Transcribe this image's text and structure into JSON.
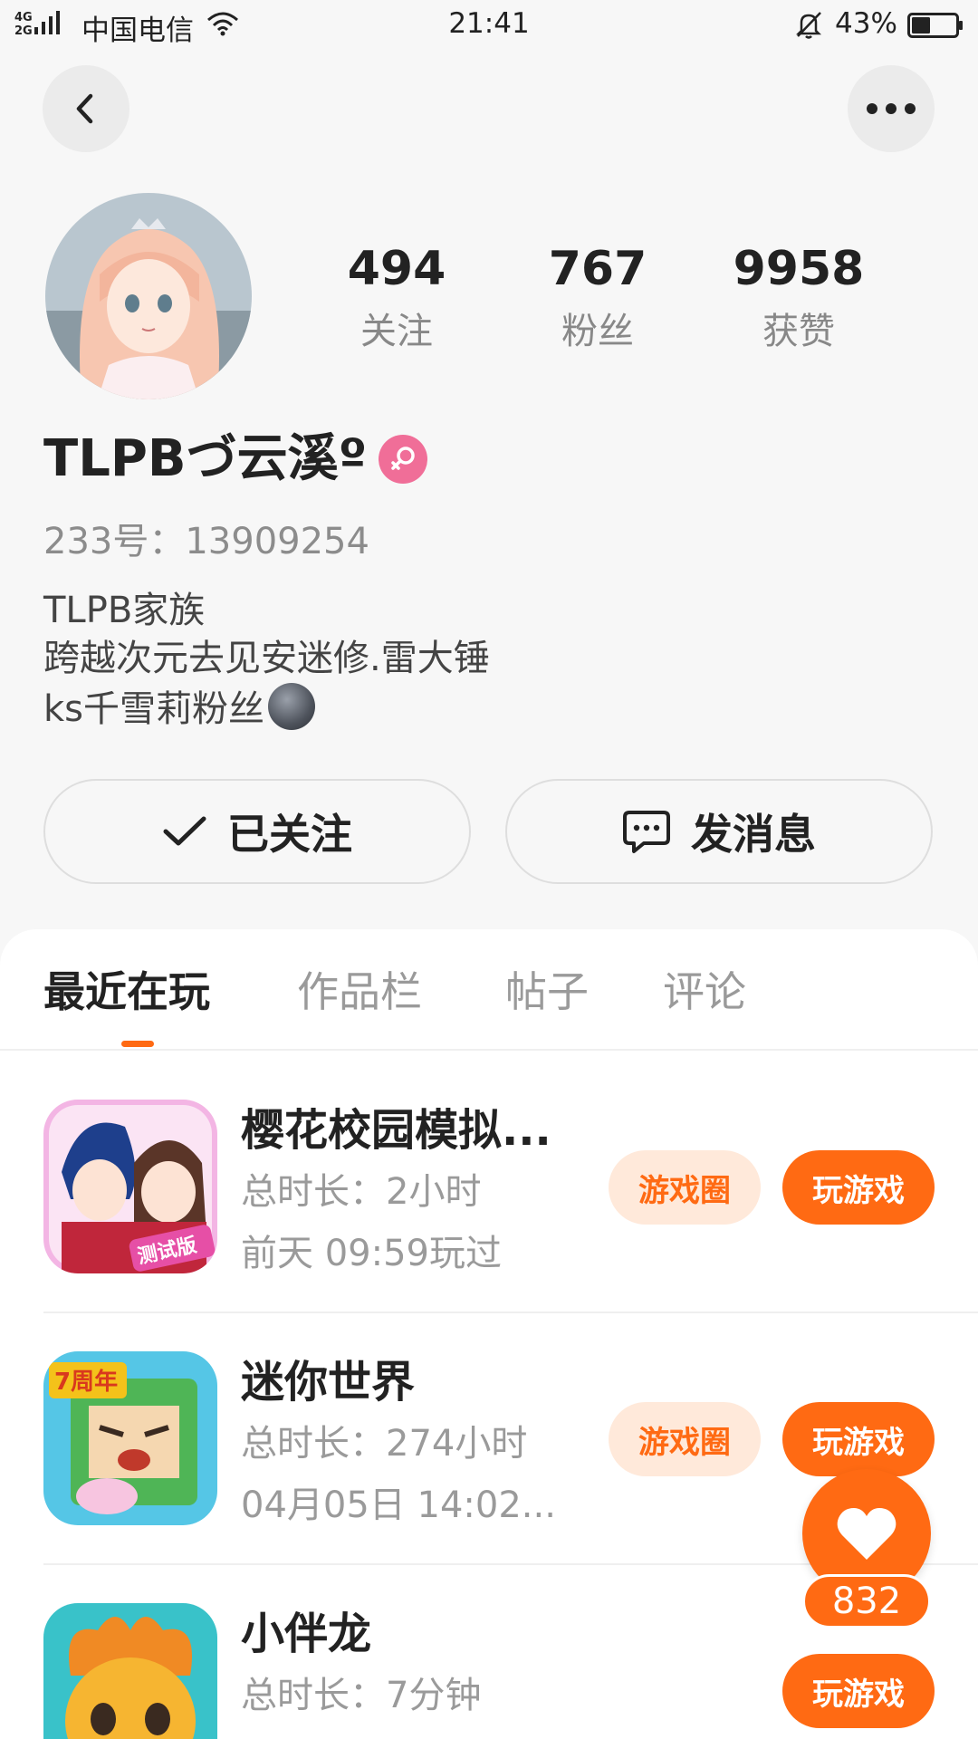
{
  "status_bar": {
    "network": "4G 2G",
    "carrier": "中国电信",
    "time": "21:41",
    "battery": "43%",
    "battery_level": 0.43
  },
  "profile": {
    "stats": [
      {
        "value": "494",
        "label": "关注"
      },
      {
        "value": "767",
        "label": "粉丝"
      },
      {
        "value": "9958",
        "label": "获赞"
      }
    ],
    "username": "TLPBづ云溪º",
    "user_id": "233号：13909254",
    "bio": [
      "TLPB家族",
      "跨越次元去见安迷修.雷大锤",
      "ks千雪莉粉丝"
    ],
    "gender": "female"
  },
  "actions": {
    "follow_label": "已关注",
    "message_label": "发消息"
  },
  "tabs": [
    {
      "label": "最近在玩",
      "active": true
    },
    {
      "label": "作品栏",
      "active": false
    },
    {
      "label": "帖子",
      "active": false
    },
    {
      "label": "评论",
      "active": false
    }
  ],
  "games": [
    {
      "name": "樱花校园模拟...",
      "duration": "总时长：2小时",
      "last_played": "前天 09:59玩过",
      "circle_label": "游戏圈",
      "play_label": "玩游戏",
      "icon_badge": "测试版"
    },
    {
      "name": "迷你世界",
      "duration": "总时长：274小时",
      "last_played": "04月05日 14:02...",
      "circle_label": "游戏圈",
      "play_label": "玩游戏",
      "icon_badge": "7周年"
    },
    {
      "name": "小伴龙",
      "duration": "总时长：7分钟",
      "play_label": "玩游戏"
    }
  ],
  "floating_like": {
    "count": "832"
  },
  "colors": {
    "accent": "#ff6a13",
    "accent_light": "#ffe9da",
    "gender_badge": "#f06e98"
  }
}
